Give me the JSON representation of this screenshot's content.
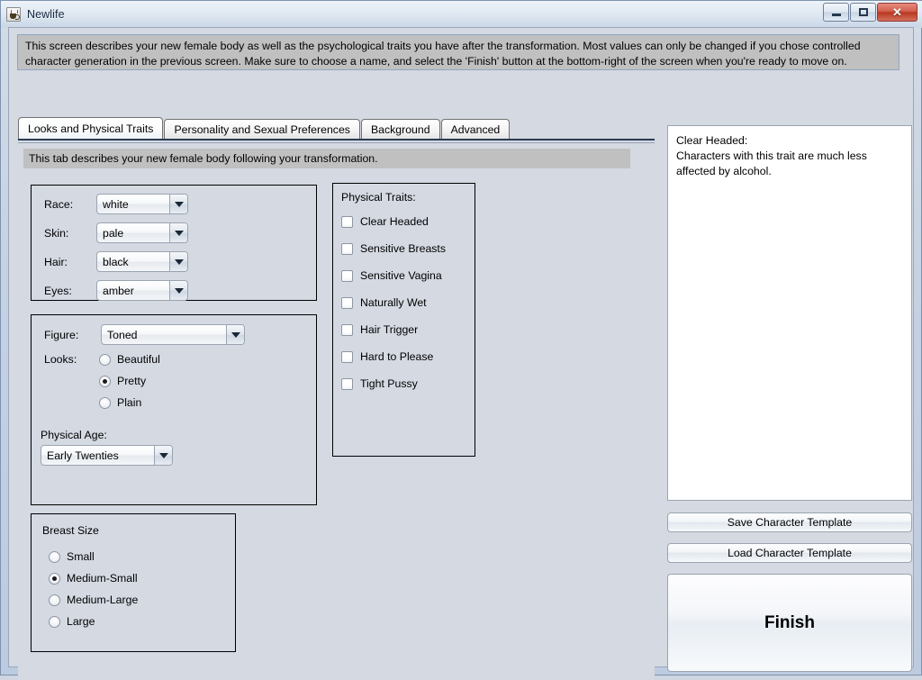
{
  "window": {
    "title": "Newlife",
    "icon": "java-cup-icon",
    "controls": {
      "minimize": "minimize-button",
      "maximize": "maximize-button",
      "close_glyph": "✕"
    }
  },
  "info_banner": {
    "text": "This screen describes your new female body as well as the psychological traits you have after the transformation. Most values can only be changed if you chose controlled character generation in the previous screen. Make sure to choose a name, and select the 'Finish' button at the bottom-right of the screen when you're ready to move on."
  },
  "tabs": [
    {
      "label": "Looks and Physical Traits",
      "active": true
    },
    {
      "label": "Personality and Sexual Preferences",
      "active": false
    },
    {
      "label": "Background",
      "active": false
    },
    {
      "label": "Advanced",
      "active": false
    }
  ],
  "tab_description": "This tab describes your new female body following your transformation.",
  "appearance_panel": {
    "fields": [
      {
        "label": "Race:",
        "value": "white"
      },
      {
        "label": "Skin:",
        "value": "pale"
      },
      {
        "label": "Hair:",
        "value": "black"
      },
      {
        "label": "Eyes:",
        "value": "amber"
      }
    ]
  },
  "figure_panel": {
    "figure_label": "Figure:",
    "figure_value": "Toned",
    "looks_label": "Looks:",
    "looks_options": [
      {
        "label": "Beautiful",
        "selected": false
      },
      {
        "label": "Pretty",
        "selected": true
      },
      {
        "label": "Plain",
        "selected": false
      }
    ],
    "age_label": "Physical Age:",
    "age_value": "Early Twenties"
  },
  "breast_panel": {
    "title": "Breast Size",
    "options": [
      {
        "label": "Small",
        "selected": false
      },
      {
        "label": "Medium-Small",
        "selected": true
      },
      {
        "label": "Medium-Large",
        "selected": false
      },
      {
        "label": "Large",
        "selected": false
      }
    ]
  },
  "traits_panel": {
    "title": "Physical Traits:",
    "items": [
      {
        "label": "Clear Headed",
        "checked": false
      },
      {
        "label": "Sensitive Breasts",
        "checked": false
      },
      {
        "label": "Sensitive Vagina",
        "checked": false
      },
      {
        "label": "Naturally Wet",
        "checked": false
      },
      {
        "label": "Hair Trigger",
        "checked": false
      },
      {
        "label": "Hard to Please",
        "checked": false
      },
      {
        "label": "Tight Pussy",
        "checked": false
      }
    ]
  },
  "description_box": {
    "heading": "Clear Headed:",
    "body": "Characters with this trait are much less affected by alcohol."
  },
  "buttons": {
    "save_template": "Save Character Template",
    "load_template": "Load Character Template",
    "finish": "Finish"
  },
  "colors": {
    "window_bg": "#cfd6e0",
    "panel_bg": "#d4d9e2",
    "banner_bg": "#c0c0c0",
    "tab_active_border": "#2a3a52",
    "close_button": "#b8371f",
    "text": "#000000"
  }
}
